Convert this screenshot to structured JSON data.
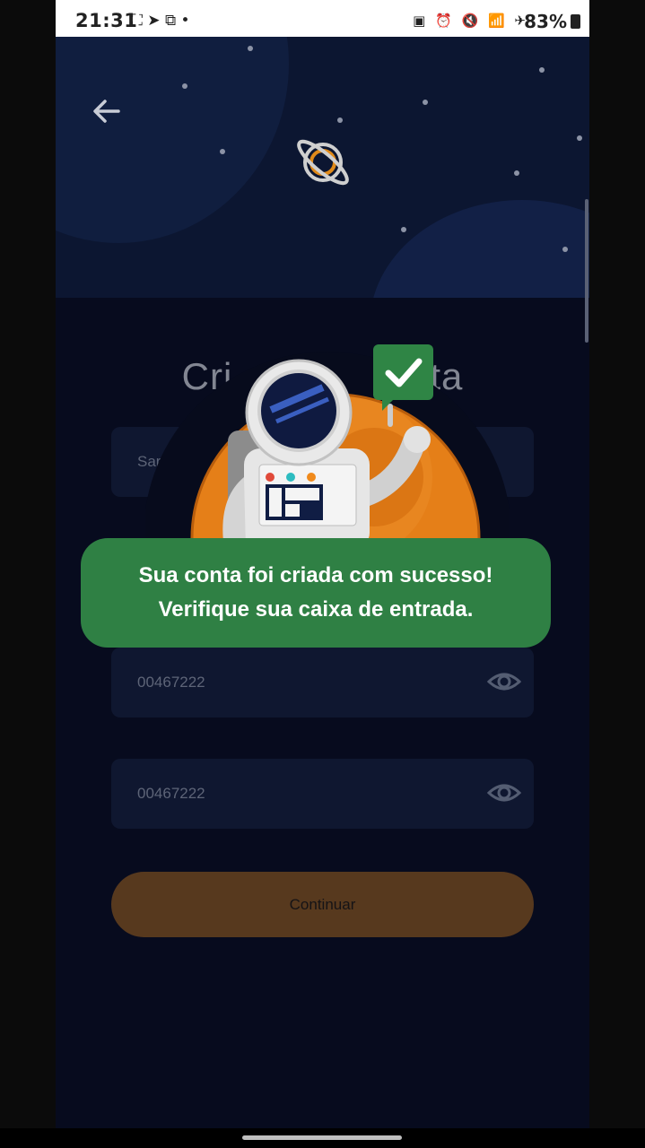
{
  "status_bar": {
    "time": "21:31",
    "left_icons": "⛶ ➤ ⧉ •",
    "right_icons": "▣ ⏰ 🔇 📶 ✈",
    "battery": "83%"
  },
  "header": {
    "back_icon": "arrow-left-icon",
    "logo_icon": "planet-icon"
  },
  "form": {
    "title_visible_left": "Cri",
    "title_visible_right": "ta",
    "field1_value_partial": "Sar",
    "password_value": "00467222",
    "confirm_password_value": "00467222",
    "continue_label": "Continuar"
  },
  "toast": {
    "line1": "Sua conta foi criada com sucesso!",
    "line2": "Verifique sua caixa de entrada."
  },
  "colors": {
    "background": "#080d22",
    "field": "#141f3e",
    "button": "#835322",
    "toast": "#2f8044",
    "planet": "#e57f18"
  }
}
